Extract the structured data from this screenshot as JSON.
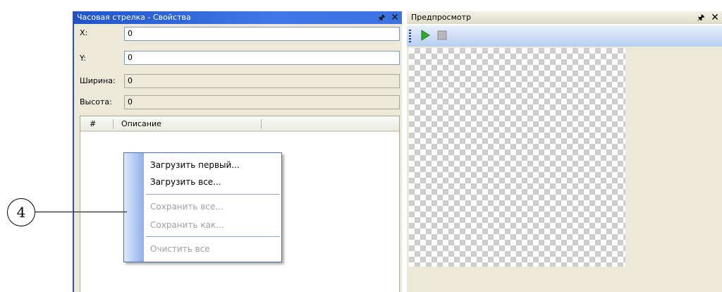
{
  "left_panel": {
    "title": "Часовая стрелка - Свойства",
    "pin_icon": "pin-icon",
    "close_icon": "close-icon",
    "fields": [
      {
        "label": "X:",
        "value": "0",
        "editable": true
      },
      {
        "label": "Y:",
        "value": "0",
        "editable": true
      },
      {
        "label": "Ширина:",
        "value": "0",
        "editable": false
      },
      {
        "label": "Высота:",
        "value": "0",
        "editable": false
      }
    ],
    "list": {
      "columns": [
        "#",
        "Описание"
      ]
    }
  },
  "context_menu": {
    "items": [
      {
        "label": "Загрузить первый...",
        "enabled": true
      },
      {
        "label": "Загрузить все...",
        "enabled": true
      },
      {
        "label": "Сохранить все...",
        "enabled": false
      },
      {
        "label": "Сохранить как...",
        "enabled": false
      },
      {
        "label": "Очистить все",
        "enabled": false
      }
    ]
  },
  "callout": {
    "number": "4"
  },
  "right_panel": {
    "title": "Предпросмотр",
    "toolbar": {
      "play_icon": "play-icon",
      "stop_icon": "stop-icon"
    }
  },
  "colors": {
    "title_bar_active": "#2a5fd6",
    "window_frame": "#2c4fb8",
    "panel_background": "#ece9d8",
    "play_green": "#2faa2f"
  }
}
